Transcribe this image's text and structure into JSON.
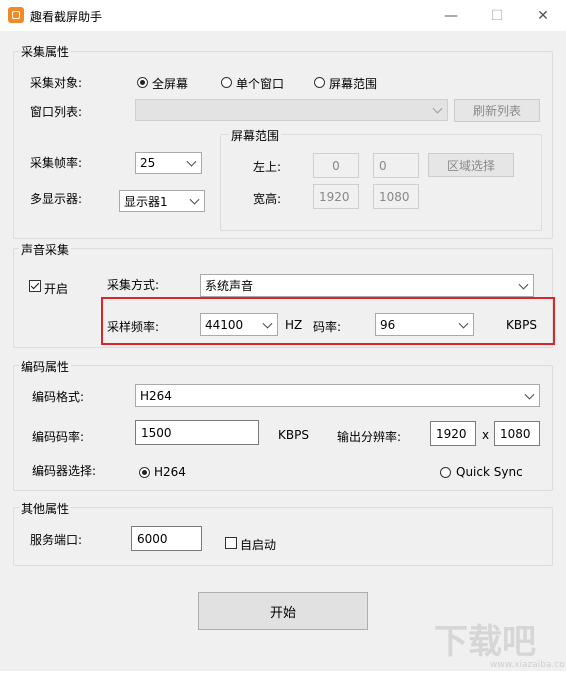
{
  "window": {
    "title": "趣看截屏助手",
    "minimize": "—",
    "maximize": "☐",
    "close": "✕"
  },
  "capture": {
    "group_title": "采集属性",
    "target_label": "采集对象:",
    "target_options": [
      "全屏幕",
      "单个窗口",
      "屏幕范围"
    ],
    "target_selected": "全屏幕",
    "window_list_label": "窗口列表:",
    "window_list_value": "",
    "refresh_button": "刷新列表",
    "framerate_label": "采集帧率:",
    "framerate_value": "25",
    "monitor_label": "多显示器:",
    "monitor_value": "显示器1",
    "region": {
      "group_title": "屏幕范围",
      "top_left_label": "左上:",
      "left_value": "0",
      "top_value": "0",
      "select_button": "区域选择",
      "size_label": "宽高:",
      "width_value": "1920",
      "height_value": "1080"
    }
  },
  "audio": {
    "group_title": "声音采集",
    "enable_label": "开启",
    "enabled": true,
    "mode_label": "采集方式:",
    "mode_value": "系统声音",
    "samplerate_label": "采样频率:",
    "samplerate_value": "44100",
    "samplerate_unit": "HZ",
    "bitrate_label": "码率:",
    "bitrate_value": "96",
    "bitrate_unit": "KBPS"
  },
  "encode": {
    "group_title": "编码属性",
    "format_label": "编码格式:",
    "format_value": "H264",
    "bitrate_label": "编码码率:",
    "bitrate_value": "1500",
    "bitrate_unit": "KBPS",
    "resolution_label": "输出分辨率:",
    "res_width": "1920",
    "res_x": "x",
    "res_height": "1080",
    "encoder_label": "编码器选择:",
    "encoder_options": [
      "H264",
      "Quick Sync"
    ],
    "encoder_selected": "H264"
  },
  "other": {
    "group_title": "其他属性",
    "port_label": "服务端口:",
    "port_value": "6000",
    "autostart_label": "自启动",
    "autostart": false
  },
  "start_button": "开始",
  "colors": {
    "highlight": "#d9262b",
    "app_icon": "#f08a24"
  }
}
